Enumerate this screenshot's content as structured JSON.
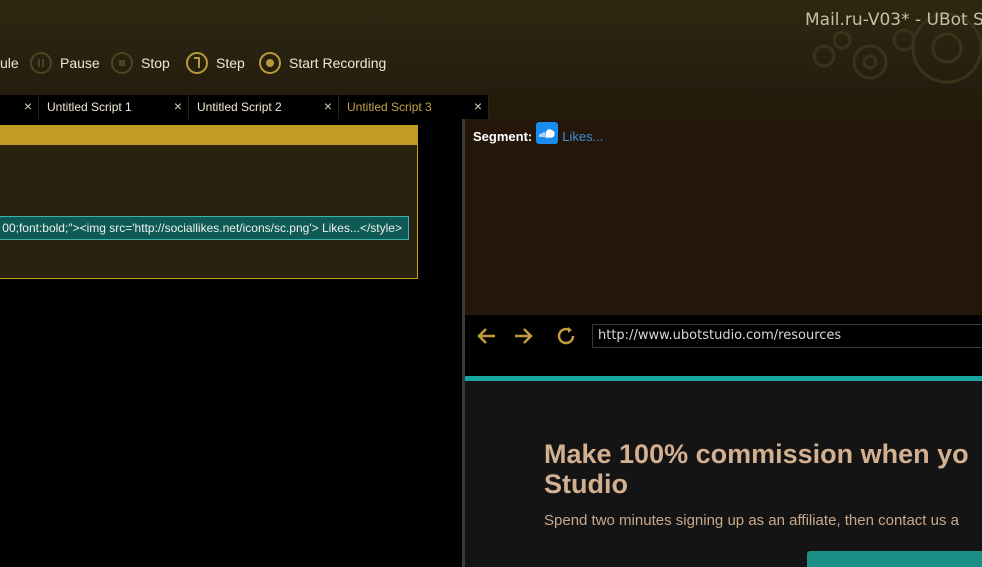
{
  "window": {
    "title": "Mail.ru-V03* - UBot St"
  },
  "toolbar": {
    "run_node_label": "ule",
    "pause_label": "Pause",
    "stop_label": "Stop",
    "step_label": "Step",
    "record_label": "Start Recording"
  },
  "tabs": [
    {
      "label": "Untitled Script 1"
    },
    {
      "label": "Untitled Script 2"
    },
    {
      "label": "Untitled Script 3"
    }
  ],
  "editor": {
    "code_snippet": "00;font:bold;\"><img src='http://sociallikes.net/icons/sc.png'> Likes...</style>"
  },
  "preview": {
    "segment_label": "Segment:",
    "segment_link": "Likes..."
  },
  "browser": {
    "url": "http://www.ubotstudio.com/resources",
    "headline": "Make 100% commission when yo Studio",
    "subline": "Spend two minutes signing up as an affiliate, then contact us a"
  },
  "colors": {
    "accent_gold": "#c39a24",
    "teal": "#1aa6a0",
    "link_blue": "#3a8fe0"
  }
}
